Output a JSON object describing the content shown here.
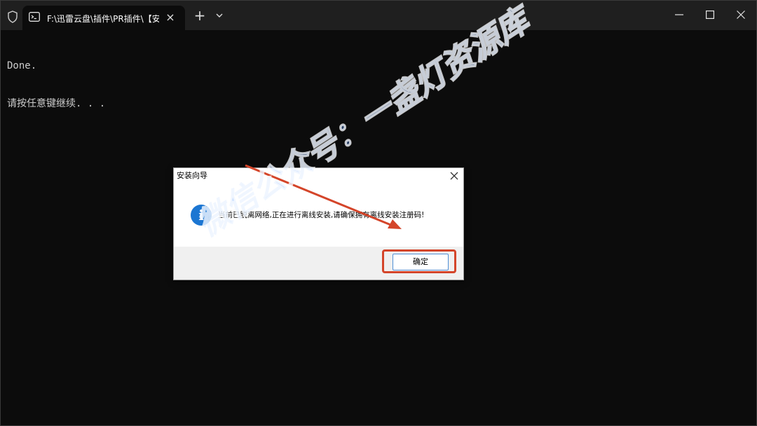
{
  "window": {
    "tab_title": "F:\\迅雷云盘\\插件\\PR插件\\【安",
    "tab_close": "×",
    "new_tab": "+",
    "controls": [
      "minimize-icon",
      "maximize-icon",
      "close-icon"
    ]
  },
  "terminal": {
    "line1": "Done.",
    "line2": "请按任意键继续. . ."
  },
  "dialog": {
    "title": "安装向导",
    "message": "当前已脱离网络,正在进行离线安装,请确保拥有离线安装注册码!",
    "ok_label": "确定",
    "icon": "info-icon"
  },
  "watermark": "微信公众号：一盏灯资源库",
  "colors": {
    "annotation_red": "#d4452a",
    "info_blue": "#1c76d2",
    "terminal_bg": "#0c0c0c"
  }
}
